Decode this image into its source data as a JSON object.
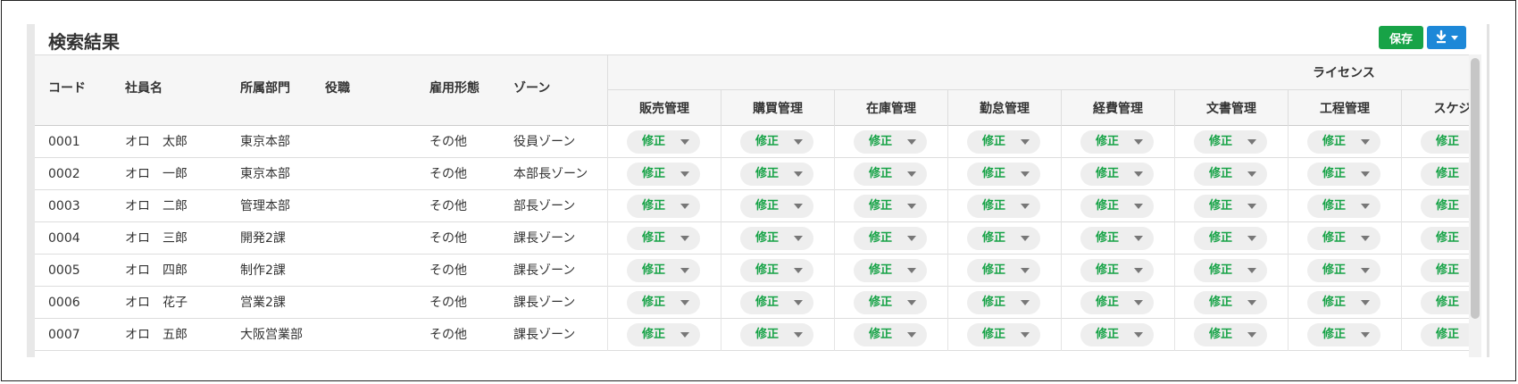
{
  "panel": {
    "title": "検索結果"
  },
  "toolbar": {
    "save_label": "保存"
  },
  "columns": {
    "code": "コード",
    "name": "社員名",
    "department": "所属部門",
    "position": "役職",
    "employment": "雇用形態",
    "zone": "ゾーン",
    "license_group": "ライセンス"
  },
  "license_columns": [
    "販売管理",
    "購買管理",
    "在庫管理",
    "勤怠管理",
    "経費管理",
    "文書管理",
    "工程管理",
    "スケジュ"
  ],
  "rows": [
    {
      "code": "0001",
      "name": "オロ　太郎",
      "department": "東京本部",
      "position": "",
      "employment": "その他",
      "zone": "役員ゾーン",
      "perms": [
        "修正",
        "修正",
        "修正",
        "修正",
        "修正",
        "修正",
        "修正",
        "修正"
      ]
    },
    {
      "code": "0002",
      "name": "オロ　一郎",
      "department": "東京本部",
      "position": "",
      "employment": "その他",
      "zone": "本部長ゾーン",
      "perms": [
        "修正",
        "修正",
        "修正",
        "修正",
        "修正",
        "修正",
        "修正",
        "修正"
      ]
    },
    {
      "code": "0003",
      "name": "オロ　二郎",
      "department": "管理本部",
      "position": "",
      "employment": "その他",
      "zone": "部長ゾーン",
      "perms": [
        "修正",
        "修正",
        "修正",
        "修正",
        "修正",
        "修正",
        "修正",
        "修正"
      ]
    },
    {
      "code": "0004",
      "name": "オロ　三郎",
      "department": "開発2課",
      "position": "",
      "employment": "その他",
      "zone": "課長ゾーン",
      "perms": [
        "修正",
        "修正",
        "修正",
        "修正",
        "修正",
        "修正",
        "修正",
        "修正"
      ]
    },
    {
      "code": "0005",
      "name": "オロ　四郎",
      "department": "制作2課",
      "position": "",
      "employment": "その他",
      "zone": "課長ゾーン",
      "perms": [
        "修正",
        "修正",
        "修正",
        "修正",
        "修正",
        "修正",
        "修正",
        "修正"
      ]
    },
    {
      "code": "0006",
      "name": "オロ　花子",
      "department": "営業2課",
      "position": "",
      "employment": "その他",
      "zone": "課長ゾーン",
      "perms": [
        "修正",
        "修正",
        "修正",
        "修正",
        "修正",
        "修正",
        "修正",
        "修正"
      ]
    },
    {
      "code": "0007",
      "name": "オロ　五郎",
      "department": "大阪営業部",
      "position": "",
      "employment": "その他",
      "zone": "課長ゾーン",
      "perms": [
        "修正",
        "修正",
        "修正",
        "修正",
        "修正",
        "修正",
        "修正",
        "修正"
      ]
    }
  ],
  "colors": {
    "save": "#17a347",
    "download": "#1d88d8",
    "perm_text": "#17a347"
  },
  "icons": {
    "download": "download-icon",
    "dropdown": "caret-down-icon"
  }
}
